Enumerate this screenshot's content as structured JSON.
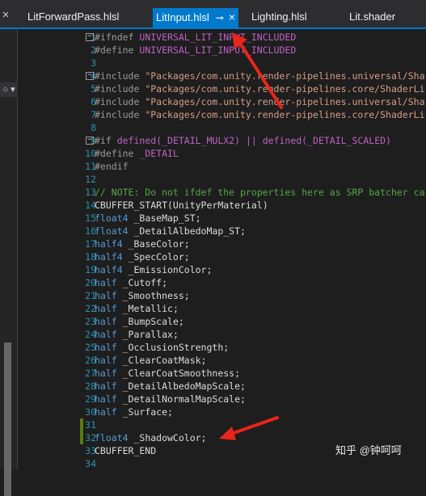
{
  "tabs": [
    {
      "label": "LitForwardPass.hlsl",
      "active": false
    },
    {
      "label": "LitInput.hlsl",
      "active": true,
      "pin_icon": "pin-icon",
      "close_icon": "close-icon"
    },
    {
      "label": "Lighting.hlsl",
      "active": false
    },
    {
      "label": "Lit.shader",
      "active": false
    }
  ],
  "side_close": "×",
  "side_selector": "○ ▾",
  "colors": {
    "accent": "#007acc",
    "background": "#1e1e1e",
    "line_numbers": "#2b91af",
    "keyword": "#569cd6",
    "string": "#d69d85",
    "macro": "#bd63c5",
    "comment": "#57a64a",
    "arrow": "#e8261c"
  },
  "code": [
    {
      "n": "1",
      "fold": "−",
      "parts": [
        [
          "pp",
          "#ifndef "
        ],
        [
          "macro",
          "UNIVERSAL_LIT_INPUT_INCLUDED"
        ]
      ]
    },
    {
      "n": "2",
      "parts": [
        [
          "pp",
          "#define "
        ],
        [
          "macro",
          "UNIVERSAL_LIT_INPUT_INCLUDED"
        ]
      ]
    },
    {
      "n": "3",
      "parts": []
    },
    {
      "n": "4",
      "fold": "−",
      "parts": [
        [
          "pp",
          "#include "
        ],
        [
          "str",
          "\"Packages/com.unity.render-pipelines.universal/Sha"
        ]
      ]
    },
    {
      "n": "5",
      "parts": [
        [
          "pp",
          "#include "
        ],
        [
          "str",
          "\"Packages/com.unity.render-pipelines.core/ShaderLi"
        ]
      ]
    },
    {
      "n": "6",
      "parts": [
        [
          "pp",
          "#include "
        ],
        [
          "str",
          "\"Packages/com.unity.render-pipelines.universal/Sha"
        ]
      ]
    },
    {
      "n": "7",
      "parts": [
        [
          "pp",
          "#include "
        ],
        [
          "str",
          "\"Packages/com.unity.render-pipelines.core/ShaderLi"
        ]
      ]
    },
    {
      "n": "8",
      "parts": []
    },
    {
      "n": "9",
      "fold": "−",
      "parts": [
        [
          "pp",
          "#if "
        ],
        [
          "macro",
          "defined(_DETAIL_MULX2) || defined(_DETAIL_SCALED)"
        ]
      ]
    },
    {
      "n": "10",
      "parts": [
        [
          "pp",
          "#define "
        ],
        [
          "macro",
          "_DETAIL"
        ]
      ]
    },
    {
      "n": "11",
      "parts": [
        [
          "pp",
          "#endif"
        ]
      ]
    },
    {
      "n": "12",
      "parts": []
    },
    {
      "n": "13",
      "parts": [
        [
          "com",
          "// NOTE: Do not ifdef the properties here as SRP batcher ca"
        ]
      ]
    },
    {
      "n": "14",
      "parts": [
        [
          "plain",
          "CBUFFER_START(UnityPerMaterial)"
        ]
      ]
    },
    {
      "n": "15",
      "parts": [
        [
          "kw",
          "float4"
        ],
        [
          "plain",
          " _BaseMap_ST;"
        ]
      ]
    },
    {
      "n": "16",
      "parts": [
        [
          "kw",
          "float4"
        ],
        [
          "plain",
          " _DetailAlbedoMap_ST;"
        ]
      ]
    },
    {
      "n": "17",
      "parts": [
        [
          "kw",
          "half4"
        ],
        [
          "plain",
          " _BaseColor;"
        ]
      ]
    },
    {
      "n": "18",
      "parts": [
        [
          "kw",
          "half4"
        ],
        [
          "plain",
          " _SpecColor;"
        ]
      ]
    },
    {
      "n": "19",
      "parts": [
        [
          "kw",
          "half4"
        ],
        [
          "plain",
          " _EmissionColor;"
        ]
      ]
    },
    {
      "n": "20",
      "parts": [
        [
          "kw",
          "half"
        ],
        [
          "plain",
          " _Cutoff;"
        ]
      ]
    },
    {
      "n": "21",
      "parts": [
        [
          "kw",
          "half"
        ],
        [
          "plain",
          " _Smoothness;"
        ]
      ]
    },
    {
      "n": "22",
      "parts": [
        [
          "kw",
          "half"
        ],
        [
          "plain",
          " _Metallic;"
        ]
      ]
    },
    {
      "n": "23",
      "parts": [
        [
          "kw",
          "half"
        ],
        [
          "plain",
          " _BumpScale;"
        ]
      ]
    },
    {
      "n": "24",
      "parts": [
        [
          "kw",
          "half"
        ],
        [
          "plain",
          " _Parallax;"
        ]
      ]
    },
    {
      "n": "25",
      "parts": [
        [
          "kw",
          "half"
        ],
        [
          "plain",
          " _OcclusionStrength;"
        ]
      ]
    },
    {
      "n": "26",
      "parts": [
        [
          "kw",
          "half"
        ],
        [
          "plain",
          " _ClearCoatMask;"
        ]
      ]
    },
    {
      "n": "27",
      "parts": [
        [
          "kw",
          "half"
        ],
        [
          "plain",
          " _ClearCoatSmoothness;"
        ]
      ]
    },
    {
      "n": "28",
      "parts": [
        [
          "kw",
          "half"
        ],
        [
          "plain",
          " _DetailAlbedoMapScale;"
        ]
      ]
    },
    {
      "n": "29",
      "parts": [
        [
          "kw",
          "half"
        ],
        [
          "plain",
          " _DetailNormalMapScale;"
        ]
      ]
    },
    {
      "n": "30",
      "parts": [
        [
          "kw",
          "half"
        ],
        [
          "plain",
          " _Surface;"
        ]
      ]
    },
    {
      "n": "31",
      "parts": []
    },
    {
      "n": "32",
      "parts": [
        [
          "kw",
          "float4"
        ],
        [
          "plain",
          " _ShadowColor;"
        ]
      ]
    },
    {
      "n": "33",
      "parts": [
        [
          "plain",
          "CBUFFER_END"
        ]
      ]
    },
    {
      "n": "34",
      "parts": []
    }
  ],
  "changed_lines": [
    "31",
    "32"
  ],
  "watermark": "知乎 @钟呵呵"
}
